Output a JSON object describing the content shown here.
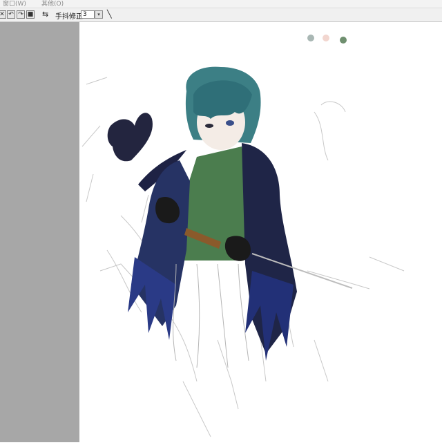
{
  "menu": {
    "items": [
      {
        "label": "窗口(W)"
      },
      {
        "label": "其他(O)"
      }
    ]
  },
  "toolbar": {
    "buttons": [
      {
        "name": "deselect-button",
        "glyph": "✕"
      },
      {
        "name": "rotate-left-button",
        "glyph": "↶"
      },
      {
        "name": "rotate-right-button",
        "glyph": "↷"
      },
      {
        "name": "reset-button",
        "glyph": "■"
      }
    ],
    "swap_glyph": "⇆",
    "stabilizer_label": "手抖修正",
    "stabilizer_value": "3",
    "dropdown_glyph": "▾",
    "line_glyph": "╲"
  },
  "colors": {
    "sidebar_bg": "#a7a7a7",
    "canvas_bg": "#ffffff",
    "palette": [
      "#a9b7b4",
      "#f2d6cf",
      "#6f8f6f"
    ]
  },
  "canvas": {
    "subject": "illustration-in-progress"
  }
}
